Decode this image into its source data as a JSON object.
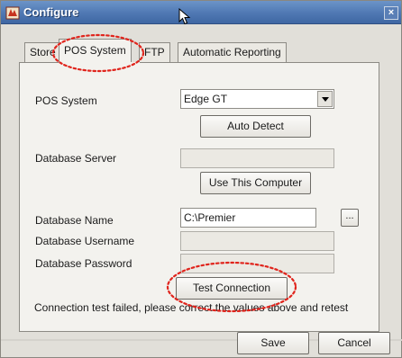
{
  "window": {
    "title": "Configure",
    "close_glyph": "×"
  },
  "tabs": [
    {
      "label": "Store"
    },
    {
      "label": "POS System",
      "active": true
    },
    {
      "label": "FTP"
    },
    {
      "label": "Automatic Reporting"
    }
  ],
  "form": {
    "pos_system_label": "POS System",
    "pos_system_value": "Edge GT",
    "auto_detect_label": "Auto Detect",
    "database_server_label": "Database Server",
    "database_server_value": "",
    "use_this_computer_label": "Use This Computer",
    "database_name_label": "Database Name",
    "database_name_value": "C:\\Premier",
    "browse_label": "...",
    "database_username_label": "Database Username",
    "database_username_value": "",
    "database_password_label": "Database Password",
    "database_password_value": "",
    "test_connection_label": "Test Connection",
    "status_text": "Connection test failed, please correct the values above and retest"
  },
  "footer": {
    "save_label": "Save",
    "cancel_label": "Cancel"
  },
  "colors": {
    "annotation": "#e0241c",
    "titlebar": "#4f78b3"
  },
  "icons": [
    "app-icon",
    "mouse-cursor-icon",
    "close-icon",
    "dropdown-arrow-icon"
  ]
}
